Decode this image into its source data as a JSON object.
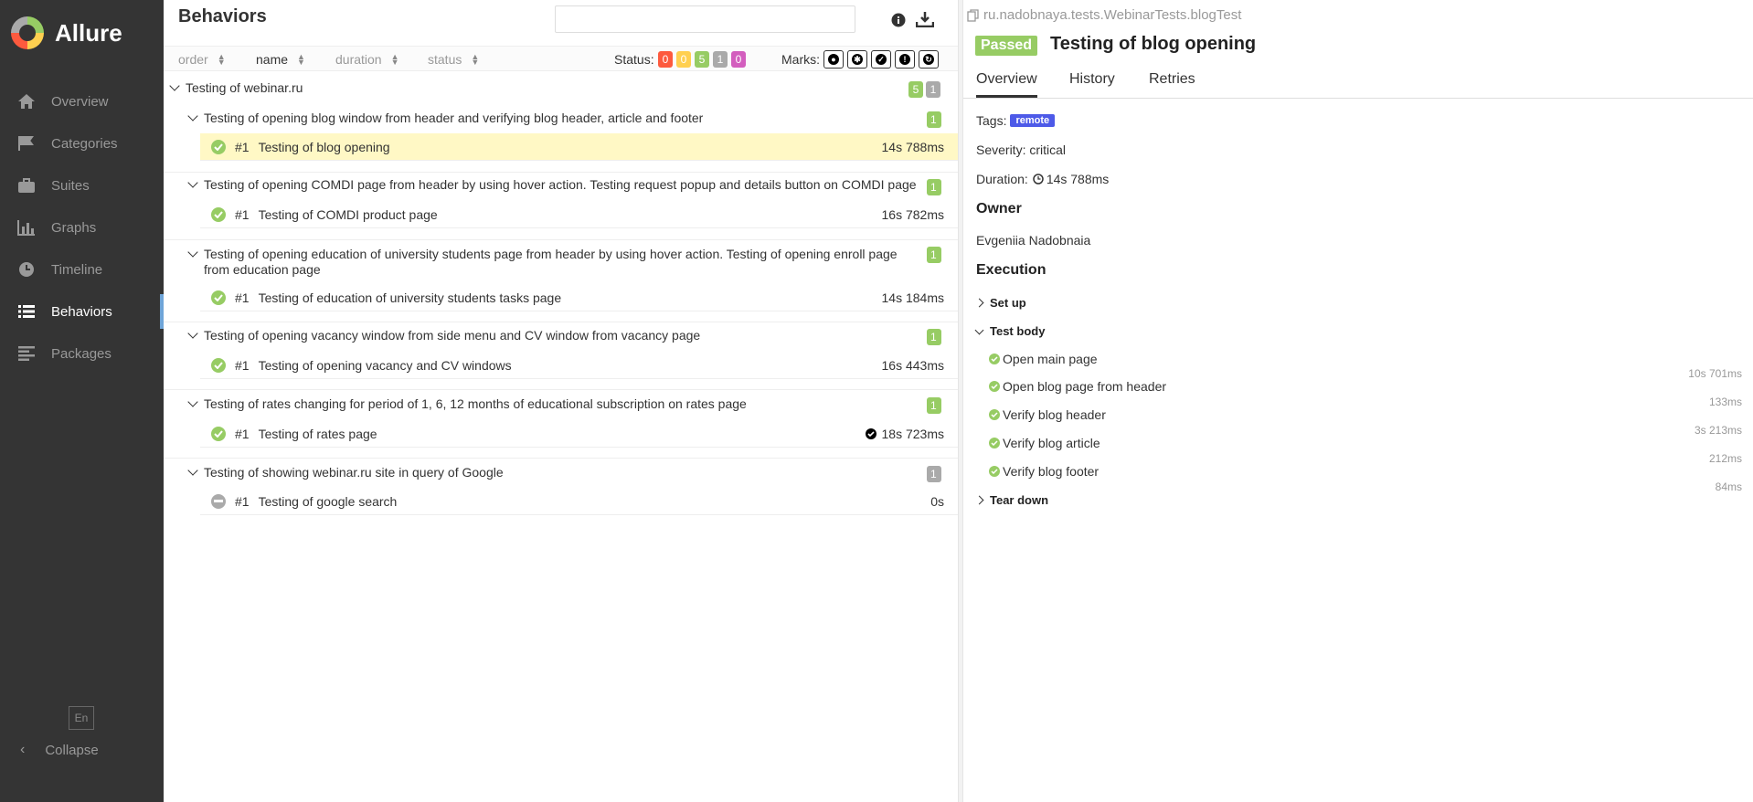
{
  "app": {
    "name": "Allure"
  },
  "sidebar": {
    "items": [
      {
        "label": "Overview",
        "icon": "home-icon"
      },
      {
        "label": "Categories",
        "icon": "flag-icon"
      },
      {
        "label": "Suites",
        "icon": "briefcase-icon"
      },
      {
        "label": "Graphs",
        "icon": "bar-chart-icon"
      },
      {
        "label": "Timeline",
        "icon": "clock-icon"
      },
      {
        "label": "Behaviors",
        "icon": "list-icon",
        "active": true
      },
      {
        "label": "Packages",
        "icon": "align-left-icon"
      }
    ],
    "lang": "En",
    "collapse_label": "Collapse"
  },
  "tree": {
    "title": "Behaviors",
    "search": {
      "value": "",
      "placeholder": ""
    },
    "sort": {
      "order": "order",
      "name": "name",
      "duration": "duration",
      "status": "status"
    },
    "status_label": "Status:",
    "status_counts": [
      {
        "value": "0",
        "color": "#fd5a3e"
      },
      {
        "value": "0",
        "color": "#ffd050"
      },
      {
        "value": "5",
        "color": "#97cc64"
      },
      {
        "value": "1",
        "color": "#aaaaaa"
      },
      {
        "value": "0",
        "color": "#d35ebe"
      }
    ],
    "marks_label": "Marks:",
    "root": {
      "title": "Testing of webinar.ru",
      "passed": "5",
      "skipped": "1"
    },
    "groups": [
      {
        "title": "Testing of opening blog window from header and verifying blog header, article and footer",
        "count": "1",
        "leaf": {
          "num": "#1",
          "name": "Testing of blog opening",
          "duration": "14s 788ms"
        }
      },
      {
        "title": "Testing of opening COMDI page from header by using hover action. Testing request popup and details button on COMDI page",
        "count": "1",
        "leaf": {
          "num": "#1",
          "name": "Testing of COMDI product page",
          "duration": "16s 782ms"
        }
      },
      {
        "title": "Testing of opening education of university students page from header by using hover action. Testing of opening enroll page from education page",
        "count": "1",
        "leaf": {
          "num": "#1",
          "name": "Testing of education of university students tasks page",
          "duration": "14s 184ms"
        }
      },
      {
        "title": "Testing of opening vacancy window from side menu and CV window from vacancy page",
        "count": "1",
        "leaf": {
          "num": "#1",
          "name": "Testing of opening vacancy and CV windows",
          "duration": "16s 443ms"
        }
      },
      {
        "title": "Testing of rates changing for period of 1, 6, 12 months of educational subscription on rates page",
        "count": "1",
        "leaf": {
          "num": "#1",
          "name": "Testing of rates page",
          "duration": "18s 723ms"
        }
      },
      {
        "title": "Testing of showing webinar.ru site in query of Google",
        "count": "1",
        "leaf": {
          "num": "#1",
          "name": "Testing of google search",
          "duration": "0s"
        }
      }
    ]
  },
  "detail": {
    "path": "ru.nadobnaya.tests.WebinarTests.blogTest",
    "status": "Passed",
    "title": "Testing of blog opening",
    "tabs": [
      "Overview",
      "History",
      "Retries"
    ],
    "tags_label": "Tags:",
    "tag": "remote",
    "severity": "Severity: critical",
    "duration_label": "Duration:",
    "duration": "14s 788ms",
    "owner_heading": "Owner",
    "owner": "Evgeniia Nadobnaia",
    "execution_heading": "Execution",
    "setup": "Set up",
    "body": "Test body",
    "teardown": "Tear down",
    "steps": [
      {
        "name": "Open main page",
        "duration": "10s 701ms"
      },
      {
        "name": "Open blog page from header",
        "duration": "133ms"
      },
      {
        "name": "Verify blog header",
        "duration": "3s 213ms"
      },
      {
        "name": "Verify blog article",
        "duration": "212ms"
      },
      {
        "name": "Verify blog footer",
        "duration": "84ms"
      }
    ]
  }
}
